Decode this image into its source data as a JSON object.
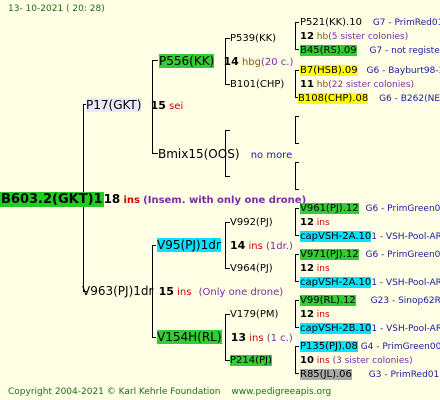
{
  "date": "13- 10-2021 ( 20: 28)",
  "root": {
    "name": "B603.2(GKT)1",
    "num": "18",
    "suffix": "ins",
    "note": "(Insem. with only one drone)"
  },
  "gen1": {
    "top": {
      "name": "P17(GKT)",
      "num": "15",
      "suffix": "sei"
    },
    "bottom": {
      "name": "V963(PJ)1dr",
      "num": "15",
      "suffix": "ins",
      "note": "(Only one drone)"
    }
  },
  "gen2": {
    "a": {
      "name": "P556(KK)",
      "num": "14",
      "suffix": "hbg",
      "note": "(20 c.)"
    },
    "b": {
      "name": "Bmix15(OOS)",
      "note": "no more"
    },
    "c": {
      "name": "V95(PJ)1dr",
      "num": "14",
      "suffix": "ins",
      "note": "(1dr.)"
    },
    "d": {
      "name": "V154H(RL)",
      "num": "13",
      "suffix": "ins",
      "note": "(1 c.)"
    }
  },
  "gen3": {
    "a1": {
      "name": "P539(KK)",
      "num": "12",
      "suffix": "hb",
      "note": "(5 sister colonies)"
    },
    "a2": {
      "name": "B101(CHP)",
      "num": "11",
      "suffix": "hb",
      "note": "(22 sister colonies)"
    },
    "c1": {
      "name": "V992(PJ)",
      "num": "12",
      "suffix": "ins"
    },
    "c2": {
      "name": "V964(PJ)",
      "num": "12",
      "suffix": "ins"
    },
    "d1": {
      "name": "V179(PM)",
      "num": "12",
      "suffix": "ins"
    },
    "d2": {
      "name": "P214(PJ)",
      "num": "10",
      "suffix": "ins",
      "note": "(3 sister colonies)"
    }
  },
  "gen4": {
    "r1": {
      "name": "P521(KK).10",
      "tail": "G7 - PrimRed01"
    },
    "r2": {
      "name": "B45(RS).09",
      "tail": "G7 - not registe"
    },
    "r3": {
      "name": "B7(HSB).09",
      "tail": "G6 - Bayburt98-3"
    },
    "r4": {
      "name": "B108(CHP).08",
      "tail": "G6 - B262(NE)"
    },
    "r5": {
      "name": "V961(PJ).12",
      "tail": "G6 - PrimGreen00"
    },
    "r6": {
      "name": "capVSH-2A.10",
      "tail": "1 - VSH-Pool-AR"
    },
    "r7": {
      "name": "V971(PJ).12",
      "tail": "G6 - PrimGreen00"
    },
    "r8": {
      "name": "capVSH-2A.10",
      "tail": "1 - VSH-Pool-AR"
    },
    "r9": {
      "name": "V99(RL).12",
      "tail": "G23 - Sinop62R"
    },
    "r10": {
      "name": "capVSH-2B.10",
      "tail": "1 - VSH-Pool-AR"
    },
    "r11": {
      "name": "P135(PJ).08",
      "tail": "G4 - PrimGreen00"
    },
    "r12": {
      "name": "R85(JL).06",
      "tail": "G3 - PrimRed01"
    }
  },
  "footer": {
    "copyright": "Copyright 2004-2021 © Karl Kehrle Foundation",
    "url": "www.pedigreeapis.org"
  }
}
